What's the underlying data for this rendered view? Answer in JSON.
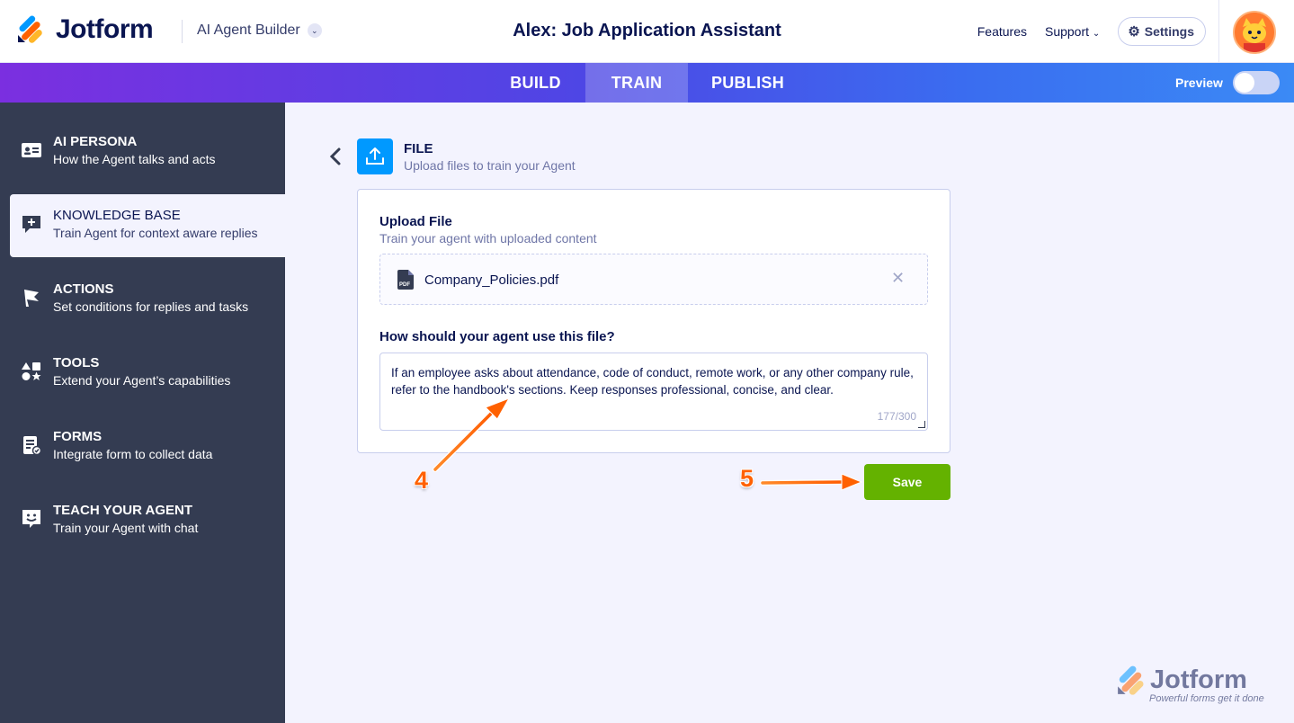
{
  "header": {
    "logo_text": "Jotform",
    "builder_label": "AI Agent Builder",
    "agent_title": "Alex: Job Application Assistant",
    "nav": [
      "Features",
      "Support"
    ],
    "settings_label": "Settings"
  },
  "tabs": [
    {
      "label": "BUILD",
      "active": false
    },
    {
      "label": "TRAIN",
      "active": true
    },
    {
      "label": "PUBLISH",
      "active": false
    }
  ],
  "preview": {
    "label": "Preview",
    "enabled": false
  },
  "sidebar": {
    "items": [
      {
        "title": "AI PERSONA",
        "subtitle": "How the Agent talks and acts",
        "icon": "id-card-icon",
        "active": false
      },
      {
        "title": "KNOWLEDGE BASE",
        "subtitle": "Train Agent for context aware replies",
        "icon": "chat-plus-icon",
        "active": true
      },
      {
        "title": "ACTIONS",
        "subtitle": "Set conditions for replies and tasks",
        "icon": "flag-icon",
        "active": false
      },
      {
        "title": "TOOLS",
        "subtitle": "Extend your Agent’s capabilities",
        "icon": "shapes-icon",
        "active": false
      },
      {
        "title": "FORMS",
        "subtitle": "Integrate form to collect data",
        "icon": "form-icon",
        "active": false
      },
      {
        "title": "TEACH YOUR AGENT",
        "subtitle": "Train your Agent with chat",
        "icon": "smiley-chat-icon",
        "active": false
      }
    ]
  },
  "file_section": {
    "title": "FILE",
    "subtitle": "Upload files to train your Agent"
  },
  "upload": {
    "title": "Upload File",
    "subtitle": "Train your agent with uploaded content",
    "file_name": "Company_Policies.pdf",
    "file_type": "PDF"
  },
  "usage": {
    "label": "How should your agent use this file?",
    "text": "If an employee asks about attendance, code of conduct, remote work, or any other company rule, refer to the handbook's sections. Keep responses professional, concise, and clear.",
    "char_count": "177/300"
  },
  "save_label": "Save",
  "annotations": {
    "step4": "4",
    "step5": "5",
    "color": "#ff6100"
  },
  "watermark": {
    "text": "Jotform",
    "tagline": "Powerful forms get it done"
  },
  "colors": {
    "primary_blue": "#0099ff",
    "save_green": "#64b200",
    "sidebar_bg": "#343c52",
    "navy": "#0a1551"
  }
}
